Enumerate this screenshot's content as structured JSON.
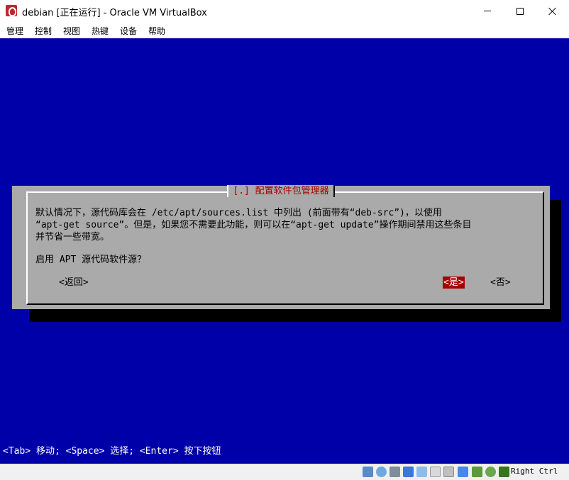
{
  "window": {
    "title": "debian [正在运行] - Oracle VM VirtualBox"
  },
  "menu": [
    "管理",
    "控制",
    "视图",
    "热键",
    "设备",
    "帮助"
  ],
  "dialog": {
    "title": "[.] 配置软件包管理器",
    "text": "默认情况下，源代码库会在 /etc/apt/sources.list 中列出 (前面带有“deb-src”)，以使用\n“apt-get source”。但是，如果您不需要此功能，则可以在“apt-get update”操作期间禁用这些条目\n并节省一些带宽。",
    "question": "启用 APT 源代码软件源？",
    "buttons": {
      "back": "<返回>",
      "yes": "<是>",
      "no": "<否>"
    }
  },
  "console_status": "<Tab> 移动; <Space> 选择; <Enter> 按下按钮",
  "statusbar": {
    "icons": [
      "hard-disk-icon",
      "optical-drive-icon",
      "audio-icon",
      "network-icon",
      "usb-icon",
      "shared-folders-icon",
      "display-icon",
      "recording-icon",
      "cpu-icon",
      "mouse-integration-icon",
      "keyboard-capture-icon"
    ],
    "host_key": "Right Ctrl"
  },
  "colors": {
    "console_background": "#0000a8",
    "dialog_background": "#aaaaaa",
    "dialog_title": "#a80000",
    "selected_button": "#a80000"
  }
}
